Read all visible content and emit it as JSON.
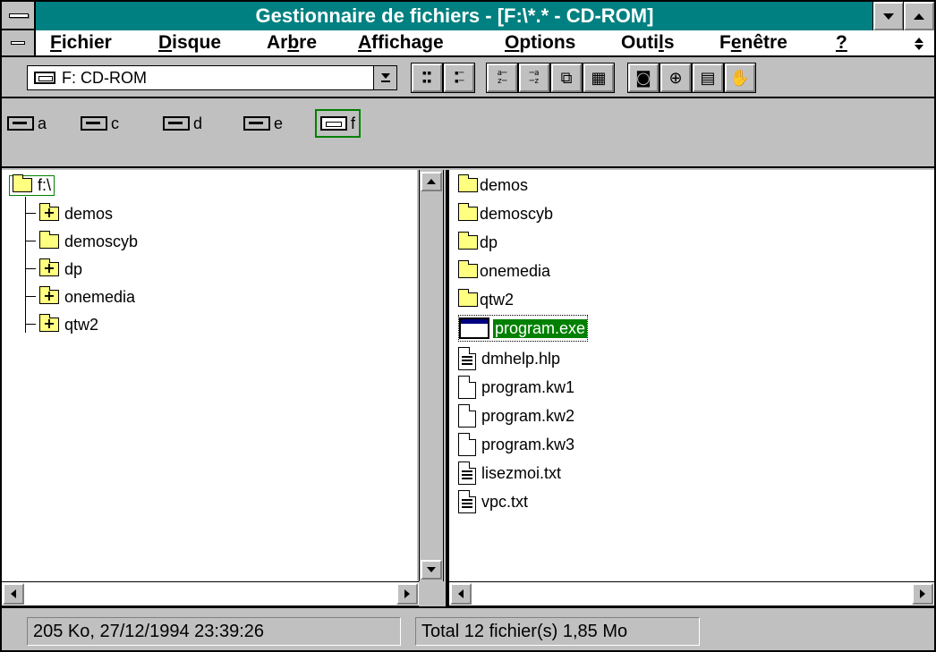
{
  "window": {
    "title": "Gestionnaire de fichiers - [F:\\*.* - CD-ROM]",
    "accent": "#008080",
    "selection_color": "#008000"
  },
  "menu": [
    {
      "before": "",
      "u": "F",
      "after": "ichier"
    },
    {
      "before": "",
      "u": "D",
      "after": "isque"
    },
    {
      "before": "Ar",
      "u": "b",
      "after": "re"
    },
    {
      "before": "",
      "u": "A",
      "after": "ffichage"
    },
    {
      "before": "",
      "u": "O",
      "after": "ptions"
    },
    {
      "before": "Outi",
      "u": "l",
      "after": "s"
    },
    {
      "before": "F",
      "u": "e",
      "after": "nêtre"
    },
    {
      "before": "",
      "u": "?",
      "after": ""
    }
  ],
  "toolbar": {
    "drive_value": "F: CD-ROM"
  },
  "drives": [
    "a",
    "c",
    "d",
    "e",
    "f"
  ],
  "tree": {
    "root": "f:\\",
    "items": [
      "demos",
      "demoscyb",
      "dp",
      "onemedia",
      "qtw2"
    ]
  },
  "files": {
    "folders": [
      "demos",
      "demoscyb",
      "dp",
      "onemedia",
      "qtw2"
    ],
    "items": [
      {
        "name": "program.exe",
        "kind": "exe"
      },
      {
        "name": "dmhelp.hlp",
        "kind": "text"
      },
      {
        "name": "program.kw1",
        "kind": "blank"
      },
      {
        "name": "program.kw2",
        "kind": "blank"
      },
      {
        "name": "program.kw3",
        "kind": "blank"
      },
      {
        "name": "lisezmoi.txt",
        "kind": "text"
      },
      {
        "name": "vpc.txt",
        "kind": "text"
      }
    ]
  },
  "status": {
    "left": "205 Ko, 27/12/1994 23:39:26",
    "right": "Total 12 fichier(s) 1,85 Mo"
  }
}
